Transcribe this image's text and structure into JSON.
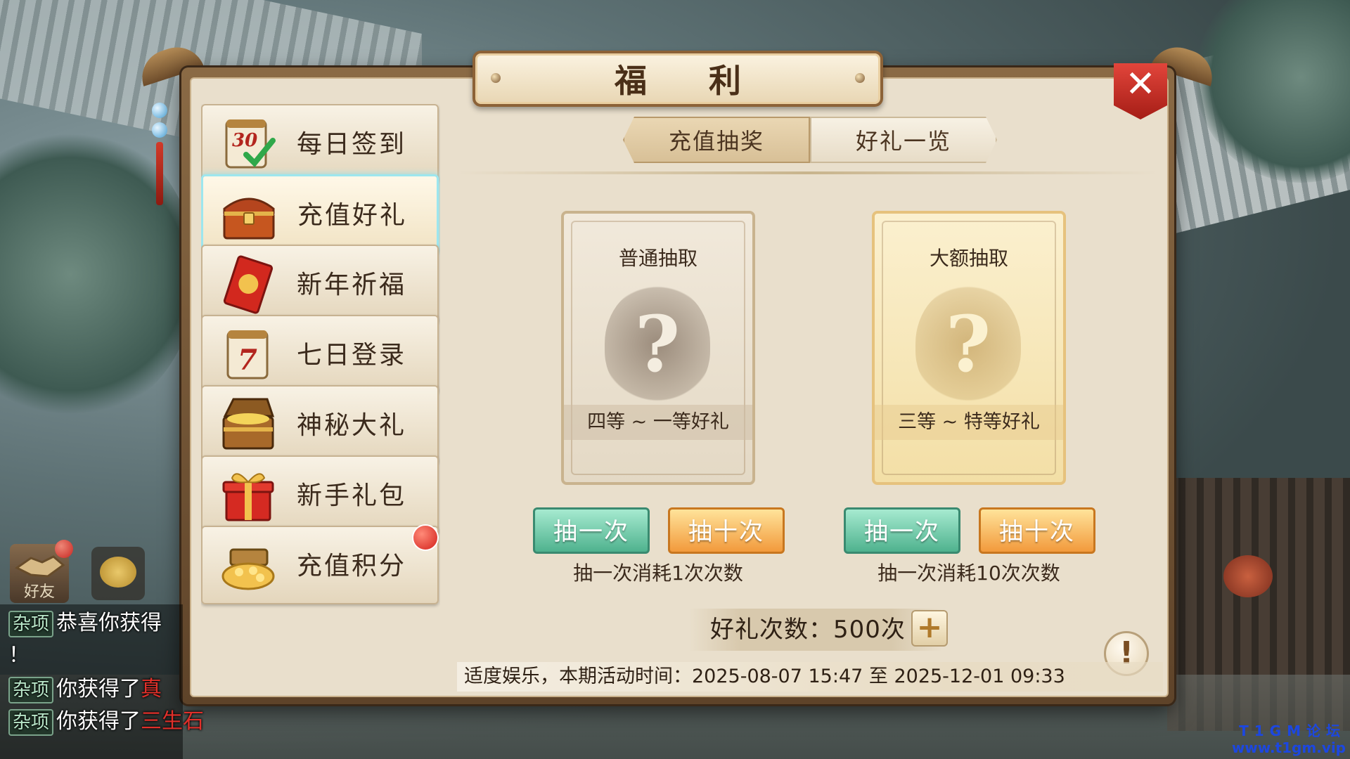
{
  "dialog": {
    "title": "福 利",
    "close_icon": "close-x-icon"
  },
  "sidebar": {
    "items": [
      {
        "label": "每日签到",
        "icon": "calendar-30-check-icon"
      },
      {
        "label": "充值好礼",
        "icon": "treasure-chest-icon",
        "active": true
      },
      {
        "label": "新年祈福",
        "icon": "red-envelope-blessing-icon"
      },
      {
        "label": "七日登录",
        "icon": "calendar-7-icon"
      },
      {
        "label": "神秘大礼",
        "icon": "open-treasure-chest-icon"
      },
      {
        "label": "新手礼包",
        "icon": "gift-box-icon"
      },
      {
        "label": "充值积分",
        "icon": "gold-ingots-icon",
        "badge": true
      }
    ]
  },
  "tabs": [
    {
      "label": "充值抽奖",
      "selected": true
    },
    {
      "label": "好礼一览",
      "selected": false
    }
  ],
  "cards": {
    "normal": {
      "title": "普通抽取",
      "prize": "四等 ~ 一等好礼",
      "draw_once": "抽一次",
      "draw_ten": "抽十次",
      "note": "抽一次消耗1次次数"
    },
    "big": {
      "title": "大额抽取",
      "prize": "三等 ~ 特等好礼",
      "draw_once": "抽一次",
      "draw_ten": "抽十次",
      "note": "抽一次消耗10次次数"
    }
  },
  "count": {
    "text": "好礼次数：500次",
    "plus": "+"
  },
  "info": "!",
  "footer": "适度娱乐，本期活动时间：2025-08-07 15:47 至 2025-12-01 09:33",
  "chat": {
    "friend_label": "好友",
    "lines": [
      {
        "tag": "杂项",
        "text": "恭喜你获得",
        "item": ""
      },
      {
        "tag": "",
        "text": "！",
        "item": ""
      },
      {
        "tag": "杂项",
        "text": "你获得了",
        "item": "真"
      },
      {
        "tag": "杂项",
        "text": "你获得了",
        "item": "三生石"
      }
    ]
  },
  "watermark": {
    "line1": "T1GM论坛",
    "line2": "www.t1gm.vip"
  },
  "colors": {
    "accent_red": "#d3201a",
    "active_glow": "#9de6ee",
    "green_button": "#4fb28e",
    "orange_button": "#f29a3c",
    "panel_bg": "#e9dfcc"
  }
}
